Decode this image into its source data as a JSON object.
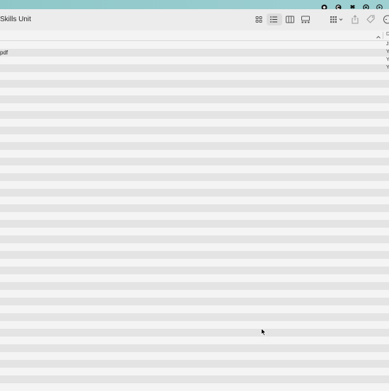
{
  "menubar": {
    "icons": [
      "record-icon",
      "grammarly-icon",
      "dropbox-icon",
      "creative-cloud-icon",
      "play-icon"
    ],
    "background": "#9ccfd1"
  },
  "window": {
    "title": "Skills Unit"
  },
  "toolbar": {
    "buttons": [
      "icon-view",
      "list-view",
      "column-view",
      "gallery-view",
      "group-by",
      "share",
      "tags",
      "more"
    ],
    "selected": "list-view"
  },
  "header": {
    "column_label": "D"
  },
  "files": [
    {
      "name": "",
      "date": "J"
    },
    {
      "name": "pdf",
      "date": "Y"
    },
    {
      "name": "",
      "date": "Y"
    },
    {
      "name": "",
      "date": "Y"
    }
  ],
  "colors": {
    "row_light": "#f4f4f4",
    "row_dark": "#e4e4e4"
  }
}
